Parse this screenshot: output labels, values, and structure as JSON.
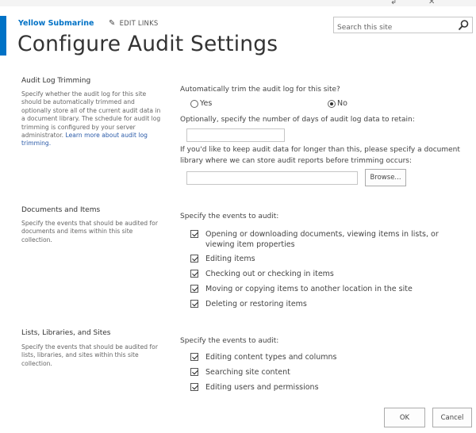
{
  "header": {
    "site_title": "Yellow Submarine",
    "edit_links": "EDIT LINKS",
    "search_placeholder": "Search this site",
    "page_title": "Configure Audit Settings"
  },
  "audit_log_trimming": {
    "heading": "Audit Log Trimming",
    "description": "Specify whether the audit log for this site should be automatically trimmed and optionally store all of the current audit data in a document library. The schedule for audit log trimming is configured by your server administrator.",
    "learn_more": "Learn more about audit log trimming.",
    "auto_trim_question": "Automatically trim the audit log for this site?",
    "options": [
      {
        "label": "Yes",
        "selected": false
      },
      {
        "label": "No",
        "selected": true
      }
    ],
    "days_label": "Optionally, specify the number of days of audit log data to retain:",
    "days_value": "",
    "library_label_line1": "If you'd like to keep audit data for longer than this, please specify a document",
    "library_label_line2": "library where we can store audit reports before trimming occurs:",
    "library_value": "",
    "browse_button": "Browse..."
  },
  "documents_and_items": {
    "heading": "Documents and Items",
    "description": "Specify the events that should be audited for documents and items within this site collection.",
    "events_label": "Specify the events to audit:",
    "events": [
      {
        "label": "Opening or downloading documents, viewing items in lists, or viewing item properties",
        "checked": true
      },
      {
        "label": "Editing items",
        "checked": true
      },
      {
        "label": "Checking out or checking in items",
        "checked": true
      },
      {
        "label": "Moving or copying items to another location in the site",
        "checked": true
      },
      {
        "label": "Deleting or restoring items",
        "checked": true
      }
    ]
  },
  "lists_libraries_sites": {
    "heading": "Lists, Libraries, and Sites",
    "description": "Specify the events that should be audited for lists, libraries, and sites within this site collection.",
    "events_label": "Specify the events to audit:",
    "events": [
      {
        "label": "Editing content types and columns",
        "checked": true
      },
      {
        "label": "Searching site content",
        "checked": true
      },
      {
        "label": "Editing users and permissions",
        "checked": true
      }
    ]
  },
  "footer": {
    "ok_button": "OK",
    "cancel_button": "Cancel"
  },
  "icons": {
    "edit": "pencil-icon",
    "search": "magnifier-icon"
  },
  "colors": {
    "accent": "#0072c6",
    "link": "#2a5aa8"
  }
}
